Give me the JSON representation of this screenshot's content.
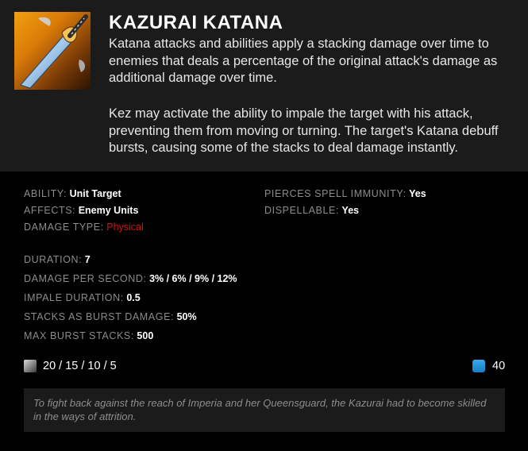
{
  "ability": {
    "name": "KAZURAI KATANA",
    "description_1": "Katana attacks and abilities apply a stacking damage over time to enemies that deals a percentage of the original attack's damage as additional damage over time.",
    "description_2": "Kez may activate the ability to impale the target with his attack, preventing them from moving or turning. The target's Katana debuff bursts, causing some of the stacks to deal damage instantly.",
    "icon": "katana-blade-icon"
  },
  "properties": {
    "ability_label": "ABILITY:",
    "ability_value": "Unit Target",
    "affects_label": "AFFECTS:",
    "affects_value": "Enemy Units",
    "damage_type_label": "DAMAGE TYPE:",
    "damage_type_value": "Physical",
    "pierces_label": "PIERCES SPELL IMMUNITY:",
    "pierces_value": "Yes",
    "dispellable_label": "DISPELLABLE:",
    "dispellable_value": "Yes"
  },
  "stats": [
    {
      "label": "DURATION:",
      "value": "7"
    },
    {
      "label": "DAMAGE PER SECOND:",
      "value": "3% / 6% / 9% / 12%"
    },
    {
      "label": "IMPALE DURATION:",
      "value": "0.5"
    },
    {
      "label": "STACKS AS BURST DAMAGE:",
      "value": "50%"
    },
    {
      "label": "MAX BURST STACKS:",
      "value": "500"
    }
  ],
  "cooldown": {
    "value": "20 / 15 / 10 / 5",
    "icon": "cooldown-icon"
  },
  "mana": {
    "value": "40",
    "icon": "mana-icon"
  },
  "lore": "To fight back against the reach of Imperia and her Queensguard, the Kazurai had to become skilled in the ways of attrition.",
  "colors": {
    "damage_physical": "#d2130f",
    "mana": "#1a8fd6",
    "header_bg": "#1b1b1b",
    "body_bg": "#000000"
  }
}
